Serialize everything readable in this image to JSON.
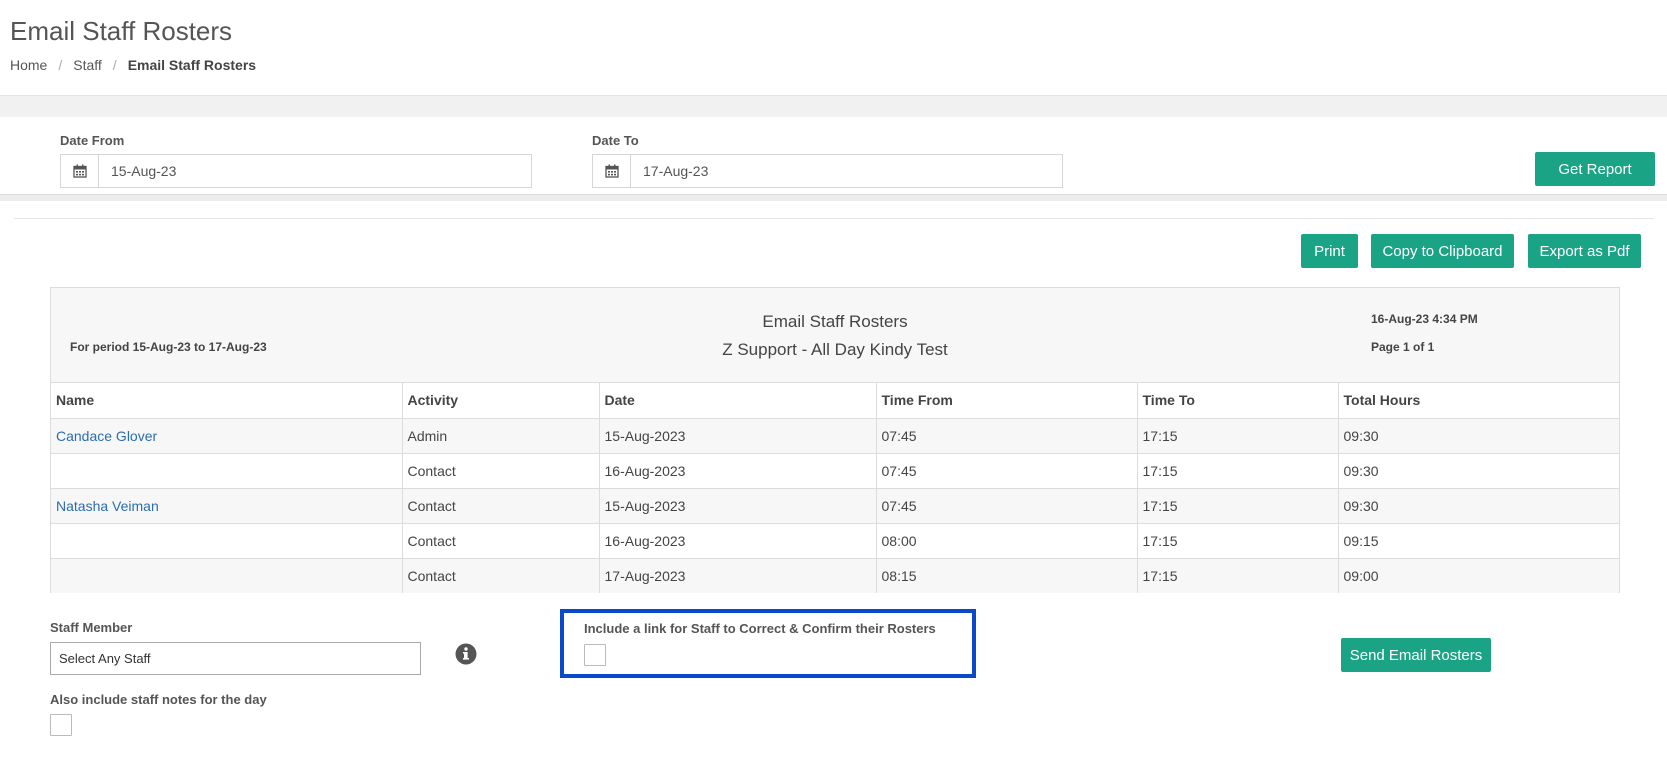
{
  "page": {
    "title": "Email Staff Rosters",
    "breadcrumb": [
      "Home",
      "Staff",
      "Email Staff Rosters"
    ]
  },
  "filters": {
    "date_from_label": "Date From",
    "date_from_value": "15-Aug-23",
    "date_to_label": "Date To",
    "date_to_value": "17-Aug-23",
    "get_report_label": "Get Report"
  },
  "toolbar": {
    "print_label": "Print",
    "copy_label": "Copy to Clipboard",
    "export_label": "Export as Pdf"
  },
  "report": {
    "period": "For period 15-Aug-23 to 17-Aug-23",
    "title": "Email Staff Rosters",
    "subtitle": "Z Support - All Day Kindy Test",
    "generated": "16-Aug-23 4:34 PM",
    "page_info": "Page 1 of 1",
    "columns": [
      "Name",
      "Activity",
      "Date",
      "Time From",
      "Time To",
      "Total Hours"
    ],
    "rows": [
      {
        "name": "Candace Glover",
        "activity": "Admin",
        "date": "15-Aug-2023",
        "time_from": "07:45",
        "time_to": "17:15",
        "total": "09:30"
      },
      {
        "name": "",
        "activity": "Contact",
        "date": "16-Aug-2023",
        "time_from": "07:45",
        "time_to": "17:15",
        "total": "09:30"
      },
      {
        "name": "Natasha Veiman",
        "activity": "Contact",
        "date": "15-Aug-2023",
        "time_from": "07:45",
        "time_to": "17:15",
        "total": "09:30"
      },
      {
        "name": "",
        "activity": "Contact",
        "date": "16-Aug-2023",
        "time_from": "08:00",
        "time_to": "17:15",
        "total": "09:15"
      },
      {
        "name": "",
        "activity": "Contact",
        "date": "17-Aug-2023",
        "time_from": "08:15",
        "time_to": "17:15",
        "total": "09:00"
      }
    ]
  },
  "email_options": {
    "staff_member_label": "Staff Member",
    "staff_member_value": "Select Any Staff",
    "correct_link_label": "Include a link for Staff to Correct & Confirm their Rosters",
    "staff_notes_label": "Also include staff notes for the day",
    "send_label": "Send Email Rosters"
  },
  "colors": {
    "accent": "#1aa384",
    "link": "#2a6db0",
    "highlight": "#0a48cc"
  }
}
